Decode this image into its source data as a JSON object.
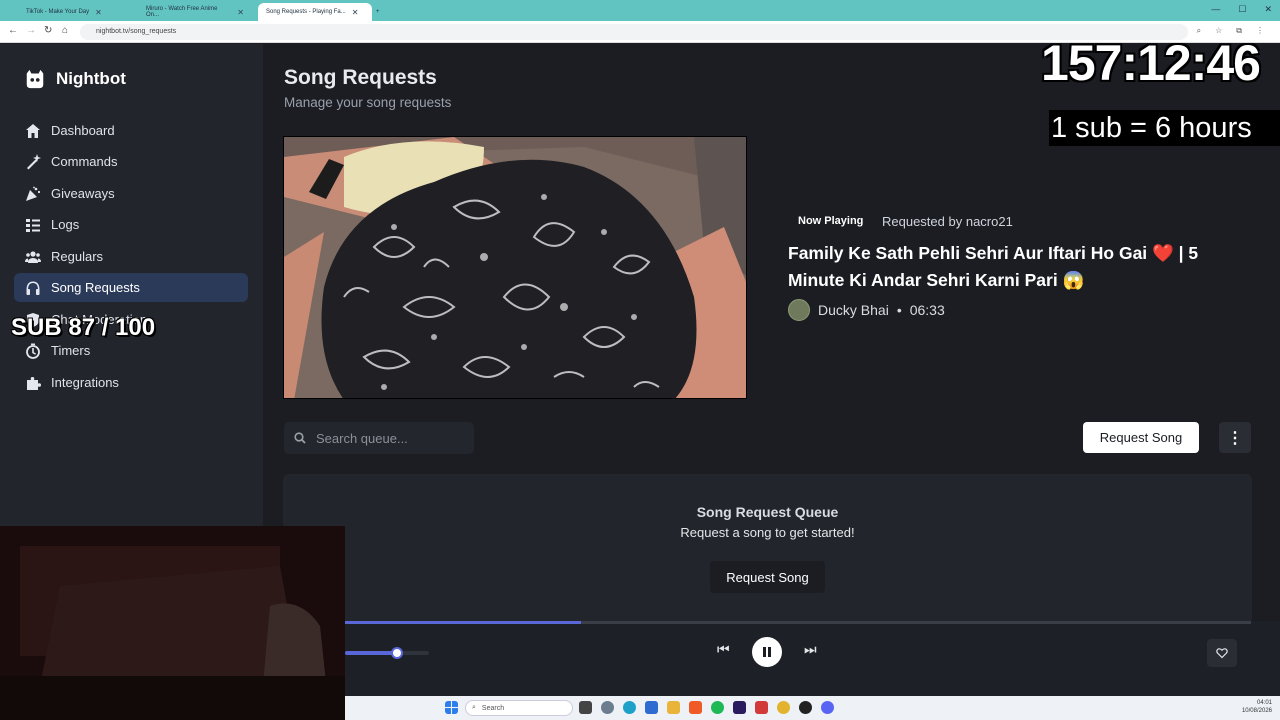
{
  "browser": {
    "tabs": [
      {
        "title": "TikTok - Make Your Day",
        "active": false
      },
      {
        "title": "Miruro - Watch Free Anime On...",
        "active": false
      },
      {
        "title": "Song Requests - Playing Fa...",
        "active": true
      }
    ],
    "url": "nightbot.tv/song_requests"
  },
  "sidebar": {
    "brand": "Nightbot",
    "items": [
      {
        "label": "Dashboard",
        "icon": "home-icon",
        "active": false
      },
      {
        "label": "Commands",
        "icon": "magic-wand-icon",
        "active": false
      },
      {
        "label": "Giveaways",
        "icon": "party-popper-icon",
        "active": false
      },
      {
        "label": "Logs",
        "icon": "list-icon",
        "active": false
      },
      {
        "label": "Regulars",
        "icon": "users-icon",
        "active": false
      },
      {
        "label": "Song Requests",
        "icon": "headphones-icon",
        "active": true
      },
      {
        "label": "Chat Moderation",
        "icon": "shield-icon",
        "active": false
      },
      {
        "label": "Timers",
        "icon": "clock-icon",
        "active": false
      },
      {
        "label": "Integrations",
        "icon": "puzzle-icon",
        "active": false
      }
    ]
  },
  "overlays": {
    "sub_goal": "SUB 87 / 100",
    "timer": "157:12:46",
    "sub_rule": "1 sub = 6 hours"
  },
  "page": {
    "title": "Song Requests",
    "subtitle": "Manage your song requests"
  },
  "now_playing": {
    "badge": "Now Playing",
    "requested_by": "Requested by nacro21",
    "title": "Family Ke Sath Pehli Sehri Aur Iftari Ho Gai ❤️ | 5 Minute Ki Andar Sehri Karni Pari 😱",
    "channel": "Ducky Bhai",
    "separator": "•",
    "duration": "06:33"
  },
  "queue": {
    "search_placeholder": "Search queue...",
    "request_button": "Request Song",
    "title": "Song Request Queue",
    "empty_text": "Request a song to get started!",
    "empty_button": "Request Song"
  },
  "player": {
    "progress_fraction": 0.26,
    "volume_fraction": 0.62
  },
  "taskbar": {
    "search_placeholder": "Search",
    "time": "04:01",
    "date": "10/08/2026"
  },
  "colors": {
    "accent": "#5a67d8",
    "sidebar_active": "#2c3a5a",
    "background": "#1b1d23"
  }
}
